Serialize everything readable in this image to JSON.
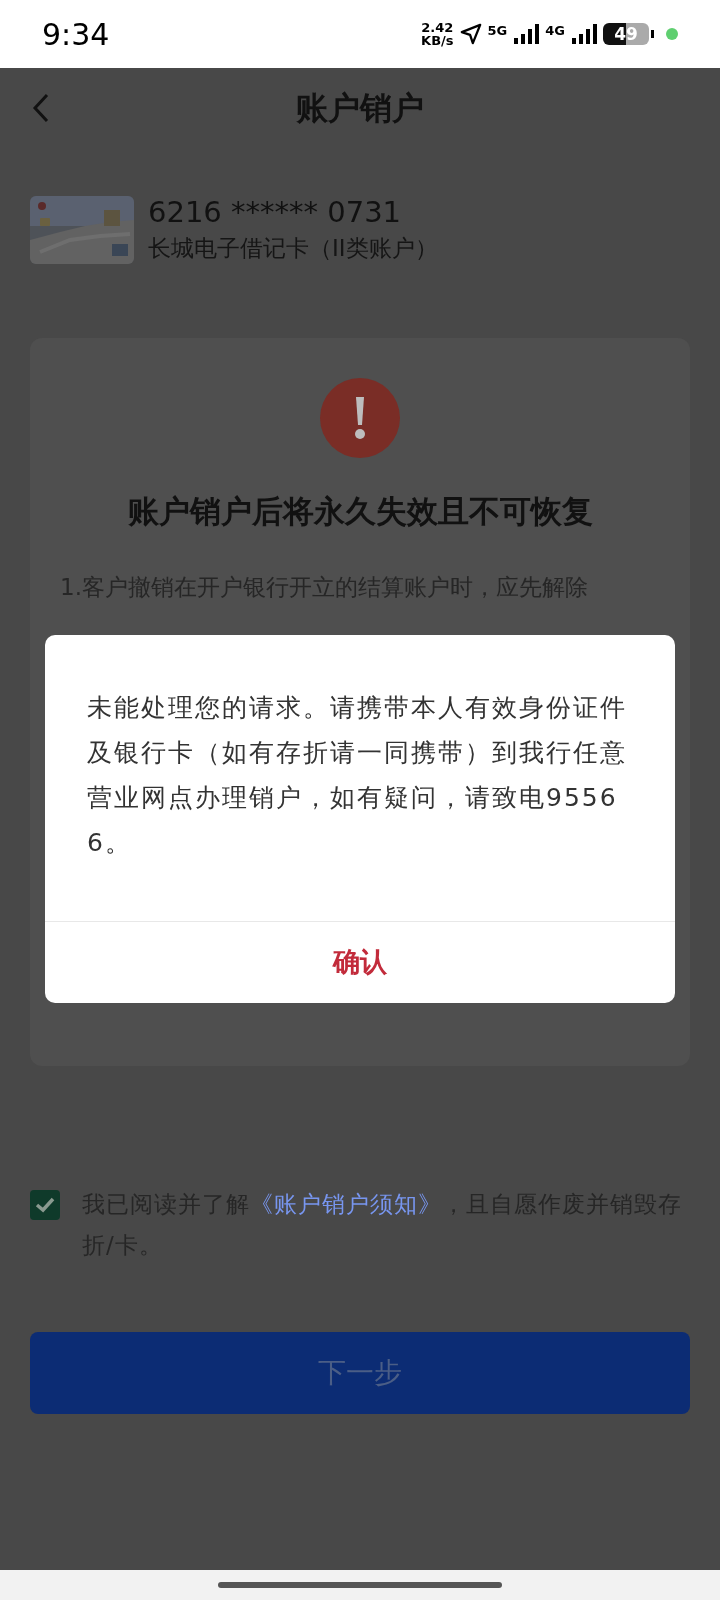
{
  "status_bar": {
    "time": "9:34",
    "speed_value": "2.42",
    "speed_unit": "KB/s",
    "sim_1": "5G",
    "sim_2": "4G",
    "battery": "49"
  },
  "header": {
    "title": "账户销户"
  },
  "account": {
    "number": "6216 ****** 0731",
    "type": "长城电子借记卡（II类账户）"
  },
  "notice": {
    "heading": "账户销户后将永久失效且不可恢复",
    "lines_top": [
      "1.客户撤销在开户银行开立的结算账户时，应先解除"
    ]
  },
  "agreement": {
    "checked": true,
    "before": "我已阅读并了解",
    "link": "《账户销户须知》",
    "after": "，且自愿作废并销毁存折/卡。"
  },
  "next_button": {
    "label": "下一步"
  },
  "dialog": {
    "message": "未能处理您的请求。请携带本人有效身份证件及银行卡（如有存折请一同携带）到我行任意营业网点办理销户，如有疑问，请致电95566。",
    "confirm": "确认"
  }
}
